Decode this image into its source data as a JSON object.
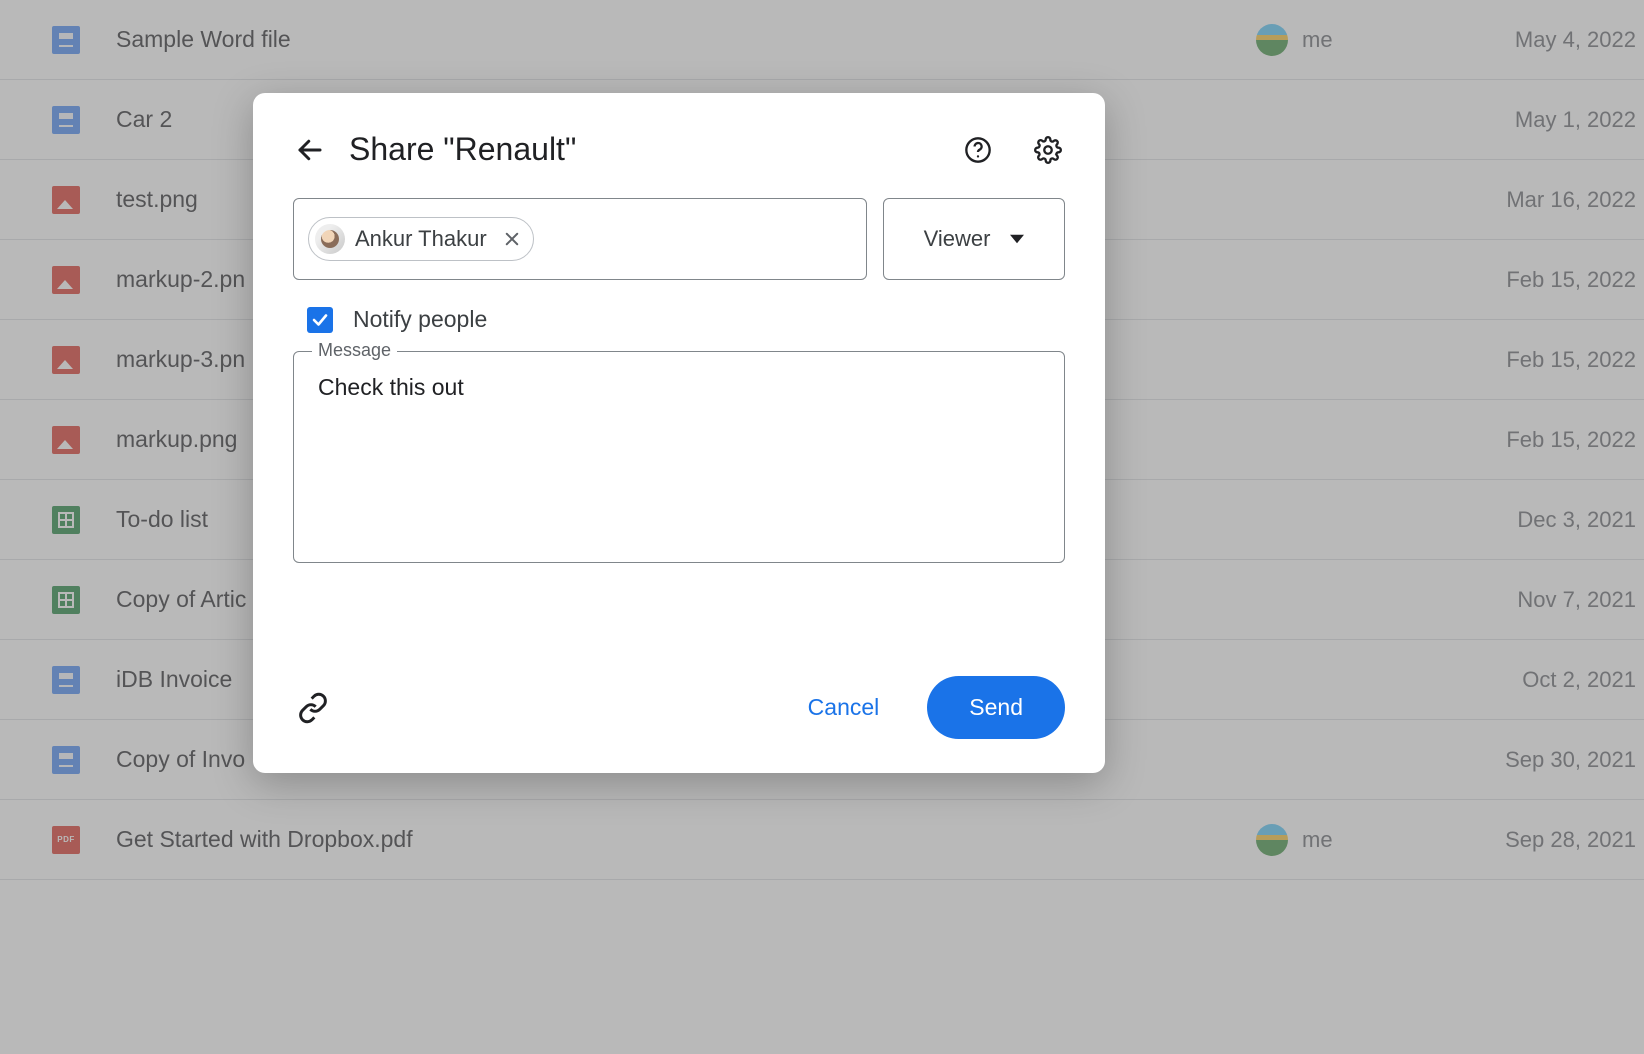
{
  "files": [
    {
      "name": "Sample Word file",
      "icon": "gdoc",
      "owner": "me",
      "showOwner": true,
      "date": "May 4, 2022"
    },
    {
      "name": "Car 2",
      "icon": "gdoc",
      "owner": "",
      "showOwner": false,
      "date": "May 1, 2022"
    },
    {
      "name": "test.png",
      "icon": "img",
      "owner": "",
      "showOwner": false,
      "date": "Mar 16, 2022"
    },
    {
      "name": "markup-2.pn",
      "icon": "img",
      "owner": "",
      "showOwner": false,
      "date": "Feb 15, 2022"
    },
    {
      "name": "markup-3.pn",
      "icon": "img",
      "owner": "",
      "showOwner": false,
      "date": "Feb 15, 2022"
    },
    {
      "name": "markup.png",
      "icon": "img",
      "owner": "",
      "showOwner": false,
      "date": "Feb 15, 2022"
    },
    {
      "name": "To-do list",
      "icon": "sheet",
      "owner": "",
      "showOwner": false,
      "date": "Dec 3, 2021"
    },
    {
      "name": "Copy of Artic",
      "icon": "sheet",
      "owner": "",
      "showOwner": false,
      "date": "Nov 7, 2021"
    },
    {
      "name": "iDB Invoice",
      "icon": "gdoc",
      "owner": "",
      "showOwner": false,
      "date": "Oct 2, 2021"
    },
    {
      "name": "Copy of Invo",
      "icon": "gdoc",
      "owner": "",
      "showOwner": false,
      "date": "Sep 30, 2021"
    },
    {
      "name": "Get Started with Dropbox.pdf",
      "icon": "pdf",
      "owner": "me",
      "showOwner": true,
      "date": "Sep 28, 2021"
    }
  ],
  "pdf_badge": "PDF",
  "dialog": {
    "title": "Share \"Renault\"",
    "person": "Ankur Thakur",
    "role": "Viewer",
    "notify_label": "Notify people",
    "notify_checked": true,
    "message_legend": "Message",
    "message_value": "Check this out",
    "cancel": "Cancel",
    "send": "Send"
  }
}
